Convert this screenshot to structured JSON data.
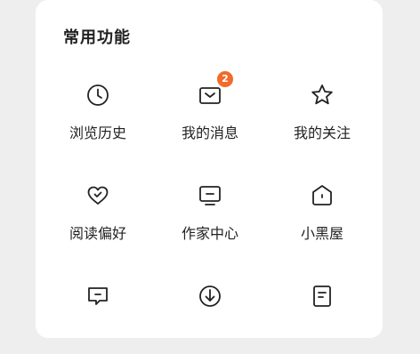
{
  "section": {
    "title": "常用功能"
  },
  "items": [
    {
      "label": "浏览历史",
      "icon": "clock-icon"
    },
    {
      "label": "我的消息",
      "icon": "message-envelope-icon",
      "badge": "2"
    },
    {
      "label": "我的关注",
      "icon": "star-icon"
    },
    {
      "label": "阅读偏好",
      "icon": "heart-check-icon"
    },
    {
      "label": "作家中心",
      "icon": "monitor-icon"
    },
    {
      "label": "小黑屋",
      "icon": "house-icon"
    },
    {
      "label": "",
      "icon": "chat-bubble-icon"
    },
    {
      "label": "",
      "icon": "download-icon"
    },
    {
      "label": "",
      "icon": "document-icon"
    }
  ],
  "colors": {
    "badge": "#f26b2a",
    "icon_stroke": "#222222",
    "background": "#eeeeee",
    "card": "#ffffff"
  }
}
